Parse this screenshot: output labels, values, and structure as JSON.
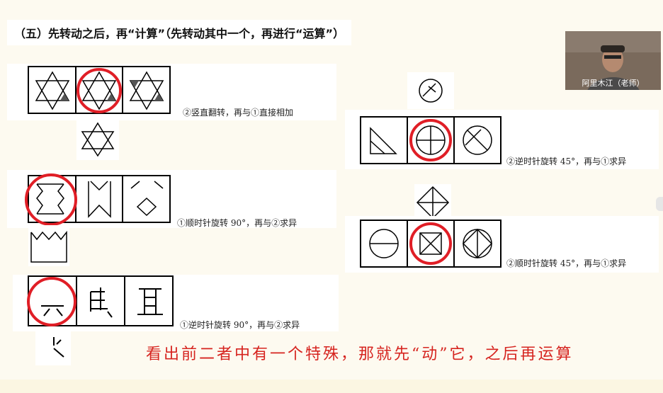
{
  "header": {
    "title": "（五）先转动之后，再“计算”（先转动其中一个，再进行“运算”）"
  },
  "video": {
    "name": "阿里木江（老师）"
  },
  "captions": {
    "p1": "②竖直翻转，再与①直接相加",
    "p2": "①顺时针旋转 90°，再与②求异",
    "p3": "①逆时针旋转 90°，再与②求异",
    "p4": "②逆时针旋转 45°，再与①求异",
    "p5": "②顺时针旋转 45°，再与①求异"
  },
  "annotation": {
    "text": "看出前二者中有一个特殊，那就先“动”它，之后再运算"
  },
  "colors": {
    "highlight": "#e01e26",
    "text": "#111111"
  }
}
